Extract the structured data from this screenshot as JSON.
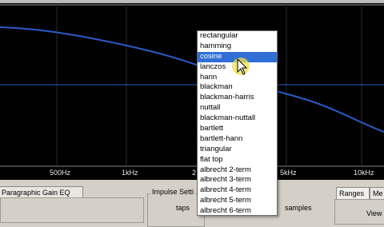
{
  "plot": {
    "background": "#000000",
    "curve_color": "#2a5cc9",
    "guide_color": "#2a5cc9",
    "x_ticks": [
      {
        "label": "500Hz"
      },
      {
        "label": "1kHz"
      },
      {
        "label": "2"
      },
      {
        "label": "5kHz"
      },
      {
        "label": "10kHz"
      }
    ]
  },
  "window_dropdown": {
    "options": [
      "rectangular",
      "hamming",
      "cosine",
      "lanczos",
      "hann",
      "blackman",
      "blackman-harris",
      "nuttall",
      "blackman-nuttall",
      "bartlett",
      "bartlett-hann",
      "triangular",
      "flat top",
      "albrecht 2-term",
      "albrecht 3-term",
      "albrecht 4-term",
      "albrecht 5-term",
      "albrecht 6-term"
    ],
    "selected": "cosine",
    "selected_color": "#2f6fd6"
  },
  "bottom_panel": {
    "tab_paragraphic": "Paragraphic Gain EQ",
    "impulse_group": "Impulse Setti",
    "taps_label": "taps",
    "samples_label": "samples",
    "tab_ranges": "Ranges",
    "tab_me": "Me",
    "view_label": "View"
  }
}
